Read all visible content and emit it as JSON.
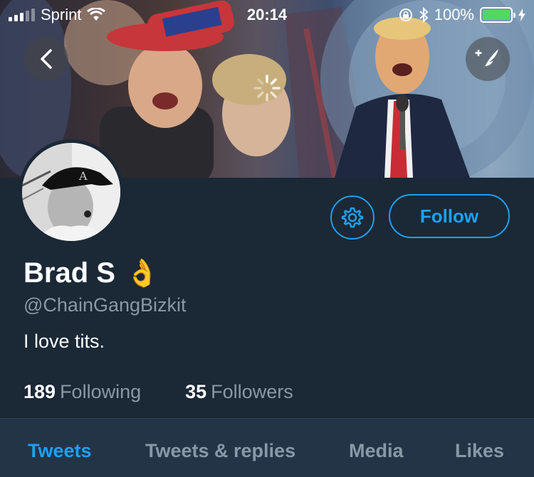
{
  "status_bar": {
    "carrier": "Sprint",
    "time": "20:14",
    "battery_percent": "100%",
    "battery_level": 1.0
  },
  "header": {
    "back_icon": "chevron-left-icon",
    "compose_icon": "compose-tweet-icon",
    "loading_icon": "spinner-icon"
  },
  "profile": {
    "name": "Brad S",
    "name_emoji": "👌",
    "handle": "@ChainGangBizkit",
    "bio": "I love tits."
  },
  "actions": {
    "settings_icon": "gear-icon",
    "follow_label": "Follow"
  },
  "stats": {
    "following_count": "189",
    "following_label": "Following",
    "followers_count": "35",
    "followers_label": "Followers"
  },
  "tabs": [
    {
      "label": "Tweets",
      "active": true
    },
    {
      "label": "Tweets & replies",
      "active": false
    },
    {
      "label": "Media",
      "active": false
    },
    {
      "label": "Likes",
      "active": false
    }
  ],
  "colors": {
    "background": "#1b2836",
    "accent": "#1da1f2",
    "secondary_text": "#8899a6",
    "tab_bar": "#243447",
    "battery_green": "#4cd964"
  }
}
